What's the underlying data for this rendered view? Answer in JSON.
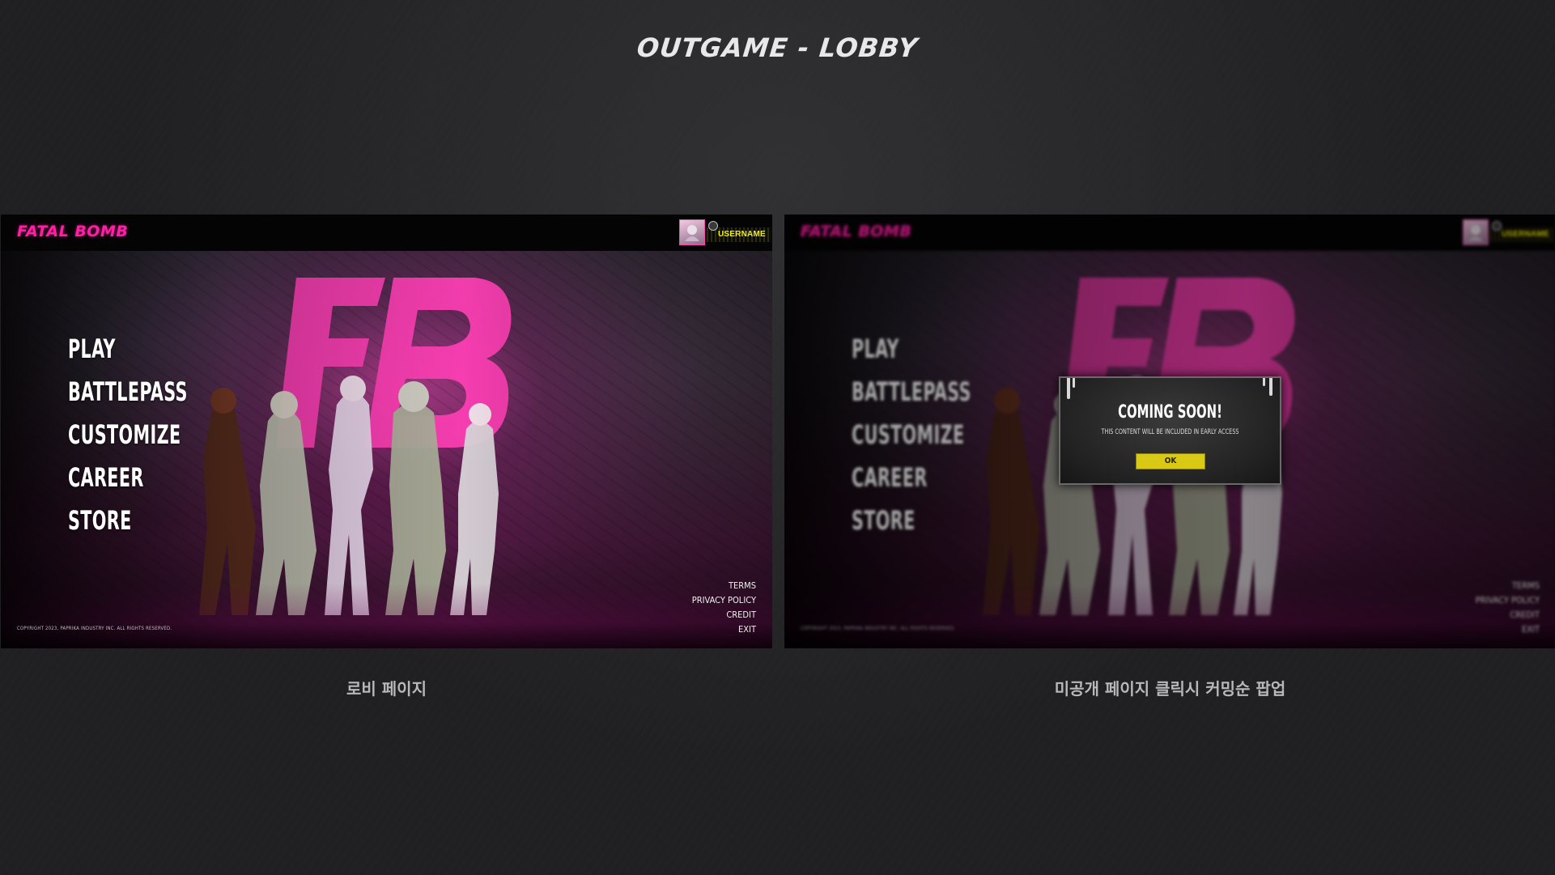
{
  "page": {
    "title": "OUTGAME - LOBBY"
  },
  "colors": {
    "brand": "#ff1fa5",
    "username": "#f4f000",
    "ok_button": "#d9c814",
    "background": "#202022"
  },
  "lobby": {
    "brand": "FATAL BOMB",
    "username": "USERNAME",
    "avatar_icon": "character-portrait",
    "menu": [
      "PLAY",
      "BATTLEPASS",
      "CUSTOMIZE",
      "CAREER",
      "STORE"
    ],
    "footer_links": [
      "TERMS",
      "PRIVACY POLICY",
      "CREDIT",
      "EXIT"
    ],
    "copyright": "COPYRIGHT 2023, PAPRIKA INDUSTRY INC. ALL RIGHTS RESERVED."
  },
  "popup": {
    "title": "COMING SOON!",
    "message": "THIS CONTENT WILL BE INCLUDED IN EARLY ACCESS",
    "ok_label": "OK"
  },
  "captions": {
    "left": "로비 페이지",
    "right": "미공개 페이지 클릭시 커밍순 팝업"
  }
}
